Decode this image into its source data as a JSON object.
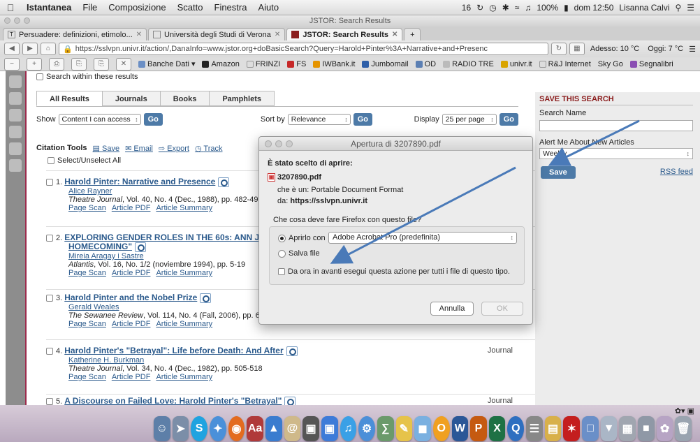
{
  "menubar": {
    "apple": "",
    "app": "Istantanea",
    "items": [
      "File",
      "Composizione",
      "Scatto",
      "Finestra",
      "Aiuto"
    ],
    "status": {
      "indicator": "16",
      "battery": "100%",
      "datetime": "dom 12:50",
      "user": "Lisanna Calvi"
    }
  },
  "browser": {
    "window_title": "JSTOR: Search Results",
    "tabs": [
      {
        "label": "Persuadere: definizioni, etimolo...",
        "favicon": "T",
        "active": false
      },
      {
        "label": "Università degli Studi di Verona",
        "favicon": "",
        "active": false
      },
      {
        "label": "JSTOR: Search Results",
        "favicon": "",
        "active": true
      }
    ],
    "new_tab": "+",
    "url": "https://sslvpn.univr.it/action/,DanaInfo=www.jstor.org+doBasicSearch?Query=Harold+Pinter%3A+Narrative+and+Presenc",
    "weather_now": "Adesso: 10 °C",
    "weather_today": "Oggi: 7 °C",
    "bookmarks": [
      "Banche Dati",
      "Amazon",
      "FRINZI",
      "FS",
      "IWBank.it",
      "Jumbomail",
      "OD",
      "RADIO TRE",
      "univr.it",
      "R&J Internet",
      "Sky Go",
      "Segnalibri"
    ]
  },
  "jstor": {
    "search_within": "Search within these results",
    "result_tabs": [
      "All Results",
      "Journals",
      "Books",
      "Pamphlets"
    ],
    "show_label": "Show",
    "show_value": "Content I can access",
    "sort_label": "Sort by",
    "sort_value": "Relevance",
    "display_label": "Display",
    "display_value": "25 per page",
    "go": "Go",
    "citation_label": "Citation Tools",
    "citation_links": [
      "Save",
      "Email",
      "Export",
      "Track"
    ],
    "select_all": "Select/Unselect All",
    "results": [
      {
        "num": "1.",
        "title": "Harold Pinter: Narrative and Presence",
        "author": "Alice Rayner",
        "journal": "Theatre Journal",
        "details": ", Vol. 40, No. 4 (Dec., 1988), pp. 482-497",
        "links": [
          "Page Scan",
          "Article PDF",
          "Article Summary"
        ],
        "type": ""
      },
      {
        "num": "2.",
        "title": "EXPLORING GENDER ROLES IN THE 60s: ANN JELLIC",
        "title2": "HOMECOMING\"",
        "author": "Mireia Aragay i Sastre",
        "journal": "Atlantis",
        "details": ", Vol. 16, No. 1/2 (noviembre 1994), pp. 5-19",
        "links": [
          "Page Scan",
          "Article PDF",
          "Article Summary"
        ],
        "type": ""
      },
      {
        "num": "3.",
        "title": "Harold Pinter and the Nobel Prize",
        "author": "Gerald Weales",
        "journal": "The Sewanee Review",
        "details": ", Vol. 114, No. 4 (Fall, 2006), pp. 603-609",
        "links": [
          "Page Scan",
          "Article PDF",
          "Article Summary"
        ],
        "type": ""
      },
      {
        "num": "4.",
        "title": "Harold Pinter's \"Betrayal\": Life before Death: And After",
        "author": "Katherine H. Burkman",
        "journal": "Theatre Journal",
        "details": ", Vol. 34, No. 4 (Dec., 1982), pp. 505-518",
        "links": [
          "Page Scan",
          "Article PDF",
          "Article Summary"
        ],
        "type": "Journal"
      },
      {
        "num": "5.",
        "title": "A Discourse on Failed Love: Harold Pinter's \"Betrayal\"",
        "author": "",
        "journal": "",
        "details": "",
        "links": [],
        "type": "Journal"
      }
    ],
    "right_panel": {
      "title": "SAVE THIS SEARCH",
      "search_name_label": "Search Name",
      "alert_label": "Alert Me About New Articles",
      "alert_value": "Weekly",
      "save": "Save",
      "rss": "RSS feed"
    }
  },
  "dialog": {
    "title": "Apertura di 3207890.pdf",
    "heading": "È stato scelto di aprire:",
    "filename": "3207890.pdf",
    "type_line": "che è un:  Portable Document Format",
    "from_label": "da:",
    "from_value": "https://sslvpn.univr.it",
    "question": "Che cosa deve fare Firefox con questo file?",
    "open_with_label": "Aprirlo con",
    "open_with_value": "Adobe Acrobat Pro (predefinita)",
    "save_file": "Salva file",
    "always": "Da ora in avanti esegui questa azione per tutti i file di questo tipo.",
    "cancel": "Annulla",
    "ok": "OK"
  },
  "colors": {
    "jstor_blue": "#2b5a8c",
    "button_blue": "#4d7aa7",
    "arrow": "#4a7ab8"
  }
}
